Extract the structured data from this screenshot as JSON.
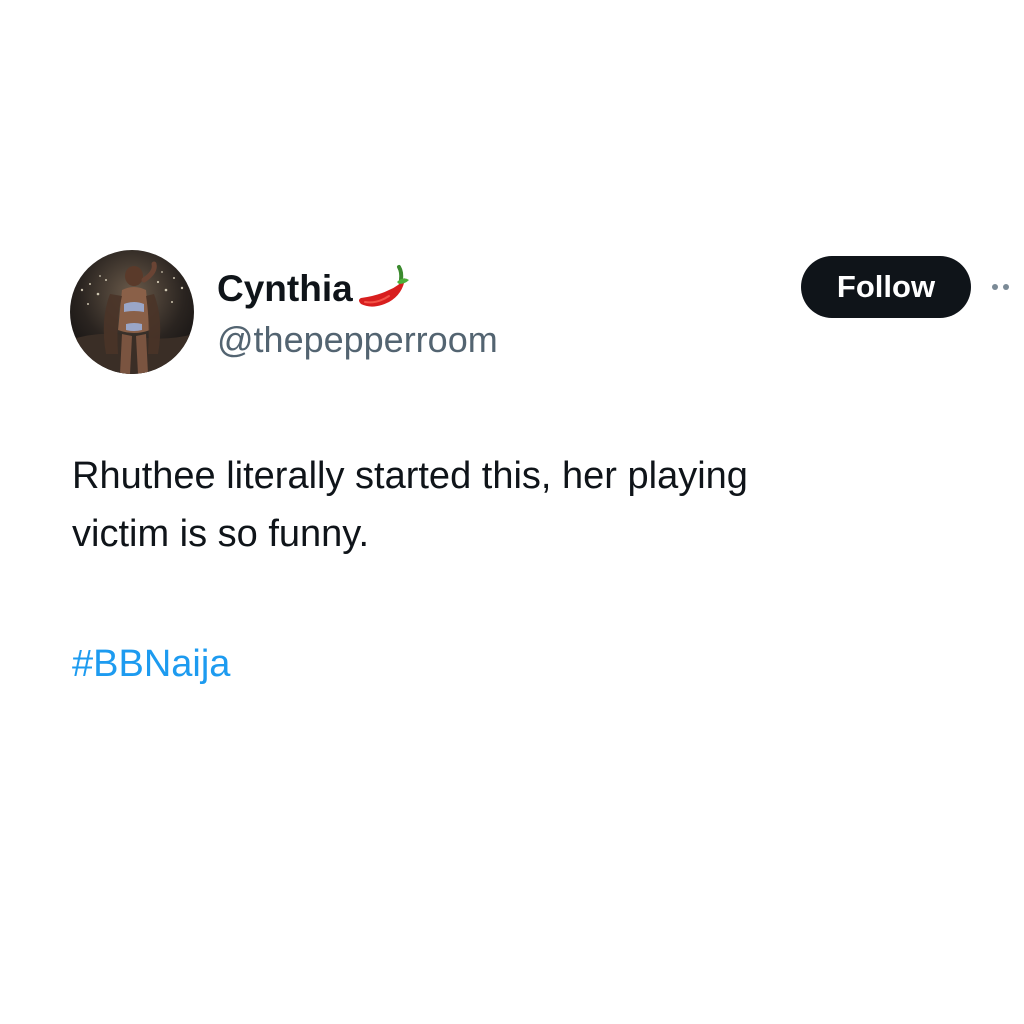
{
  "tweet": {
    "author": {
      "display_name": "Cynthia",
      "name_emoji_icon": "chili-pepper-icon",
      "handle": "@thepepperroom",
      "avatar": "profile-photo"
    },
    "follow_label": "Follow",
    "more_icon": "more-options-icon",
    "text_lines": [
      "Rhuthee literally started this, her playing",
      "victim is so funny."
    ],
    "hashtag": "#BBNaija"
  },
  "colors": {
    "text_primary": "#0f1419",
    "text_secondary": "#536471",
    "link": "#1d9bf0",
    "button_bg": "#0f1419",
    "button_text": "#ffffff",
    "background": "#ffffff"
  }
}
